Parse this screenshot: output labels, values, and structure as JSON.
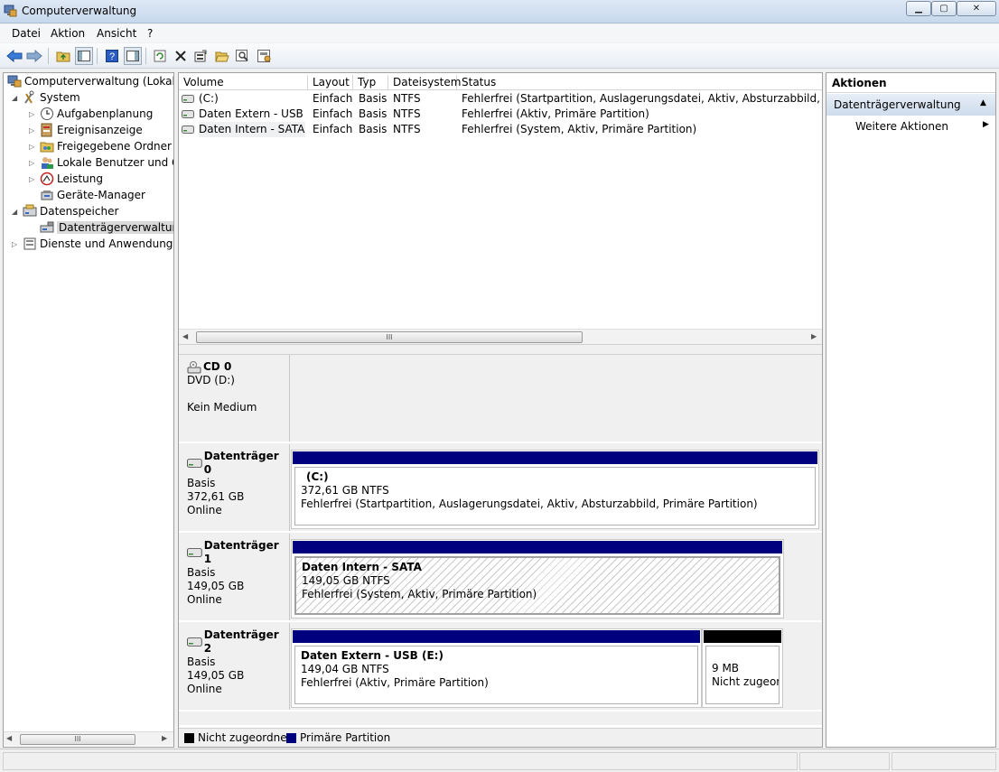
{
  "window": {
    "title": "Computerverwaltung",
    "min": "▁",
    "max": "▢",
    "close": "✕"
  },
  "menu": [
    "Datei",
    "Aktion",
    "Ansicht",
    "?"
  ],
  "tree": {
    "root": "Computerverwaltung (Lokal)",
    "system": "System",
    "aufgaben": "Aufgabenplanung",
    "ereignis": "Ereignisanzeige",
    "freigaben": "Freigegebene Ordner",
    "benutzer": "Lokale Benutzer und Gruppen",
    "leistung": "Leistung",
    "geraete": "Geräte-Manager",
    "datenspeicher": "Datenspeicher",
    "datentraeger": "Datenträgerverwaltung",
    "dienste": "Dienste und Anwendungen",
    "scroll_label": "III"
  },
  "volumes": {
    "headers": [
      "Volume",
      "Layout",
      "Typ",
      "Dateisystem",
      "Status"
    ],
    "rows": [
      {
        "volume": "(C:)",
        "layout": "Einfach",
        "typ": "Basis",
        "fs": "NTFS",
        "status": "Fehlerfrei (Startpartition, Auslagerungsdatei, Aktiv, Absturzabbild, Primäre Partition)"
      },
      {
        "volume": "Daten Extern - USB (E:)",
        "layout": "Einfach",
        "typ": "Basis",
        "fs": "NTFS",
        "status": "Fehlerfrei (Aktiv, Primäre Partition)"
      },
      {
        "volume": "Daten Intern - SATA",
        "layout": "Einfach",
        "typ": "Basis",
        "fs": "NTFS",
        "status": "Fehlerfrei (System, Aktiv, Primäre Partition)"
      }
    ],
    "scroll_label": "III"
  },
  "disks": {
    "cd": {
      "name": "CD 0",
      "type": "DVD (D:)",
      "state": "Kein Medium"
    },
    "d0": {
      "name": "Datenträger 0",
      "type": "Basis",
      "size": "372,61 GB",
      "state": "Online",
      "p_name": "(C:)",
      "p_size": "372,61 GB NTFS",
      "p_status": "Fehlerfrei (Startpartition, Auslagerungsdatei, Aktiv, Absturzabbild, Primäre Partition)"
    },
    "d1": {
      "name": "Datenträger 1",
      "type": "Basis",
      "size": "149,05 GB",
      "state": "Online",
      "p_name": "Daten Intern - SATA",
      "p_size": "149,05 GB NTFS",
      "p_status": "Fehlerfrei (System, Aktiv, Primäre Partition)"
    },
    "d2": {
      "name": "Datenträger 2",
      "type": "Basis",
      "size": "149,05 GB",
      "state": "Online",
      "p_name": "Daten Extern - USB  (E:)",
      "p_size": "149,04 GB NTFS",
      "p_status": "Fehlerfrei (Aktiv, Primäre Partition)",
      "u_size": "9 MB",
      "u_status": "Nicht zugeordnet"
    }
  },
  "legend": {
    "unallocated": "Nicht zugeordnet",
    "primary": "Primäre Partition"
  },
  "colors": {
    "primary": "#00007f",
    "unallocated": "#000000"
  },
  "actions": {
    "title": "Aktionen",
    "section": "Datenträgerverwaltung",
    "more": "Weitere Aktionen"
  }
}
